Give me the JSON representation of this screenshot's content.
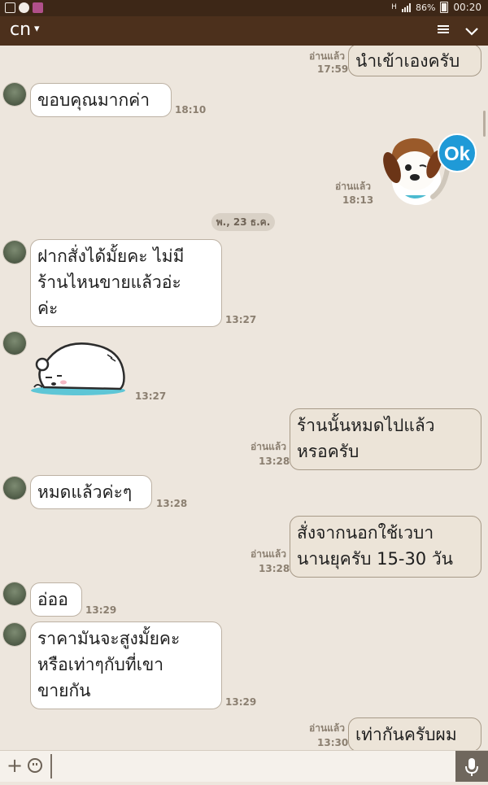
{
  "status_bar": {
    "battery": "86%",
    "time": "00:20",
    "network": "H"
  },
  "header": {
    "title": "cn",
    "menu_icon": "list-icon",
    "collapse_icon": "chevron-down-icon"
  },
  "colors": {
    "header_bg": "#4c301c",
    "status_bg": "#3d2717",
    "chat_bg": "#ede6dd",
    "sticker_bear_base": "#5ec6d6"
  },
  "date_separator": "พ., 23 ธ.ค.",
  "messages": [
    {
      "dir": "out",
      "text": "นำเข้าเองครับ",
      "read": "อ่านแล้ว",
      "time": "17:59"
    },
    {
      "dir": "in",
      "text": "ขอบคุณมากค่า",
      "time": "18:10"
    },
    {
      "dir": "out",
      "type": "sticker",
      "sticker": "dog-ok-sticker",
      "sticker_text": "Ok",
      "read": "อ่านแล้ว",
      "time": "18:13"
    },
    {
      "dir": "in",
      "text": "ฝากสั่งได้มั้ยคะ ไม่มี\nร้านไหนขายแล้วอ่ะ\nค่ะ",
      "time": "13:27"
    },
    {
      "dir": "in",
      "type": "sticker",
      "sticker": "sleeping-bear-sticker",
      "time": "13:27"
    },
    {
      "dir": "out",
      "text": "ร้านนั้นหมดไปแล้ว\nหรอครับ",
      "read": "อ่านแล้ว",
      "time": "13:28"
    },
    {
      "dir": "in",
      "text": "หมดแล้วค่ะๆ",
      "time": "13:28"
    },
    {
      "dir": "out",
      "text": "สั่งจากนอกใช้เวบา\nนานยุครับ 15-30 วัน",
      "read": "อ่านแล้ว",
      "time": "13:28"
    },
    {
      "dir": "in",
      "text": "อ่ออ",
      "time": "13:29"
    },
    {
      "dir": "in",
      "text": "ราคามันจะสูงมั้ยคะ\nหรือเท่าๆกับที่เขา\nขายกัน",
      "time": "13:29"
    },
    {
      "dir": "out",
      "text": "เท่ากันครับผม",
      "read": "อ่านแล้ว",
      "time": "13:30"
    }
  ]
}
